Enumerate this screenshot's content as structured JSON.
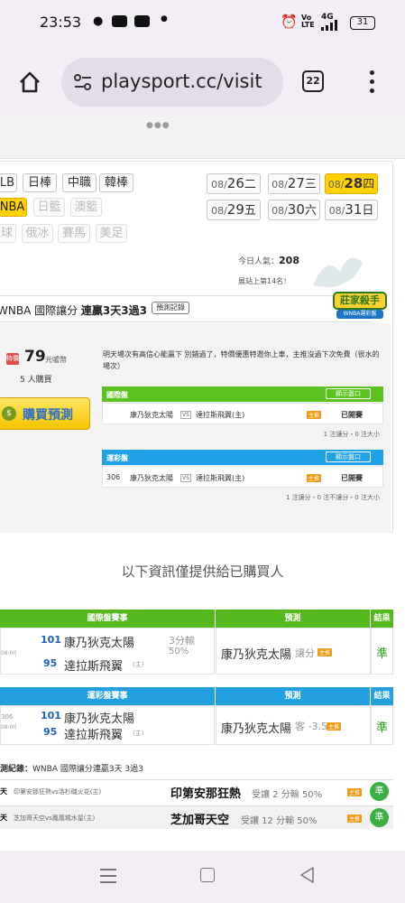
{
  "status": {
    "time": "23:53",
    "battery": "31",
    "network": "4G"
  },
  "browser": {
    "url": "playsport.cc/visit",
    "tab_count": "22"
  },
  "sports": {
    "row1": [
      "LB",
      "日棒",
      "中職",
      "韓棒"
    ],
    "row2": [
      "NBA",
      "日籃",
      "澳籃"
    ],
    "row3": [
      "足球",
      "俄冰",
      "賽馬",
      "美足"
    ]
  },
  "dates": [
    {
      "prefix": "08/",
      "day": "26",
      "wd": "二"
    },
    {
      "prefix": "08/",
      "day": "27",
      "wd": "三"
    },
    {
      "prefix": "08/",
      "day": "28",
      "wd": "四"
    },
    {
      "prefix": "08/",
      "day": "29",
      "wd": "五"
    },
    {
      "prefix": "08/",
      "day": "30",
      "wd": "六"
    },
    {
      "prefix": "08/",
      "day": "31",
      "wd": "日"
    }
  ],
  "popularity": {
    "label": "今日人氣：",
    "value": "208",
    "rank": "展站上第14名！"
  },
  "section": {
    "title_a": "WNBA 國際讓分 ",
    "title_b": "連贏3天3過3",
    "record_btn": "預測記錄",
    "logo_text": "莊家殺手",
    "logo_sub": "WNBA運彩盤"
  },
  "price": {
    "tag": "特價",
    "amount": "79",
    "unit": "元噓幣",
    "buyers": "5 人購買",
    "buy_btn": "購買預測"
  },
  "note": "明天場次有高信心能贏下 別錯過了，特價優惠特邀你上車，主推沒過下次免費（很水的場次）",
  "intl": {
    "header": "國際盤",
    "show_btn": "顯示盤口",
    "away": "康乃狄克太陽",
    "vs": "VS",
    "home": "達拉斯飛翼(主)",
    "badge": "主推",
    "status": "已開賽",
    "summary": "1 注讓分・0 注大小"
  },
  "lottery": {
    "header": "運彩盤",
    "show_btn": "顯示盤口",
    "num": "306",
    "away": "康乃狄克太陽",
    "vs": "VS",
    "home": "達拉斯飛翼(主)",
    "badge": "主推",
    "status": "已開賽",
    "summary": "1 注讓分・0 注不讓分・0 注大小"
  },
  "buyers_only": "以下資訊僅提供給已購買人",
  "table1": {
    "col_game": "國際盤賽事",
    "col_pred": "預測",
    "col_result": "結果",
    "time": "08:00",
    "away_num": "101",
    "away": "康乃狄克太陽",
    "home_num": "95",
    "home": "達拉斯飛翼",
    "home_tag": "(主)",
    "line": "3分輸",
    "line2": "50%",
    "pick": "康乃狄克太陽",
    "pick_type": "讓分",
    "badge": "主推",
    "result": "準"
  },
  "table2": {
    "col_game": "運彩盤賽事",
    "col_pred": "預測",
    "col_result": "結果",
    "num": "306",
    "time": "08:00",
    "away_num": "101",
    "away": "康乃狄克太陽",
    "home_num": "95",
    "home": "達拉斯飛翼",
    "home_tag": "(主)",
    "pick": "康乃狄克太陽",
    "pick_type": "客 -3.5",
    "badge": "主推",
    "result": "準"
  },
  "history": {
    "title_a": "測紀錄：",
    "title_b": "WNBA 國際讓分連贏3天 3過3",
    "rows": [
      {
        "day": "天",
        "match": "印第安那狂熱vs洛杉磯火花(主)",
        "pick": "印第安那狂熱",
        "line": "受讓 2 分輸 50%",
        "badge": "主推",
        "result": "準"
      },
      {
        "day": "天",
        "match": "芝加哥天空vs鳳凰城水星(主)",
        "pick": "芝加哥天空",
        "line": "受讓 12 分輸 50%",
        "badge": "主推",
        "result": "準"
      }
    ]
  },
  "colors": {
    "accent_yellow": "#ffd200",
    "green": "#5bc21f",
    "blue": "#1fa2e8",
    "orange": "#f39a17"
  }
}
